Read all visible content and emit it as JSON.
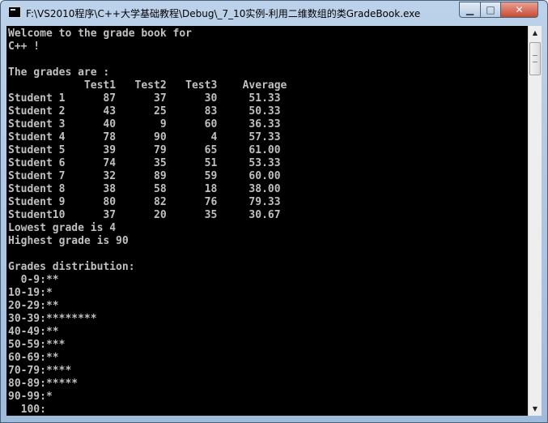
{
  "window": {
    "title": "F:\\VS2010程序\\C++大学基础教程\\Debug\\_7_10实例-利用二维数组的类GradeBook.exe",
    "icon": "console-app-icon"
  },
  "controls": {
    "minimize": "▁",
    "maximize": "□",
    "close": "✕"
  },
  "console": {
    "lines": [
      "Welcome to the grade book for",
      "C++ !",
      "",
      "The grades are :",
      "            Test1   Test2   Test3    Average",
      "Student 1      87      37      30     51.33",
      "Student 2      43      25      83     50.33",
      "Student 3      40       9      60     36.33",
      "Student 4      78      90       4     57.33",
      "Student 5      39      79      65     61.00",
      "Student 6      74      35      51     53.33",
      "Student 7      32      89      59     60.00",
      "Student 8      38      58      18     38.00",
      "Student 9      80      82      76     79.33",
      "Student10      37      20      35     30.67",
      "Lowest grade is 4",
      "Highest grade is 90",
      "",
      "Grades distribution:",
      "  0-9:**",
      "10-19:*",
      "20-29:**",
      "30-39:********",
      "40-49:**",
      "50-59:***",
      "60-69:**",
      "70-79:****",
      "80-89:*****",
      "90-99:*",
      "  100:"
    ]
  },
  "scrollbar": {
    "up_arrow": "▲",
    "down_arrow": "▼"
  }
}
